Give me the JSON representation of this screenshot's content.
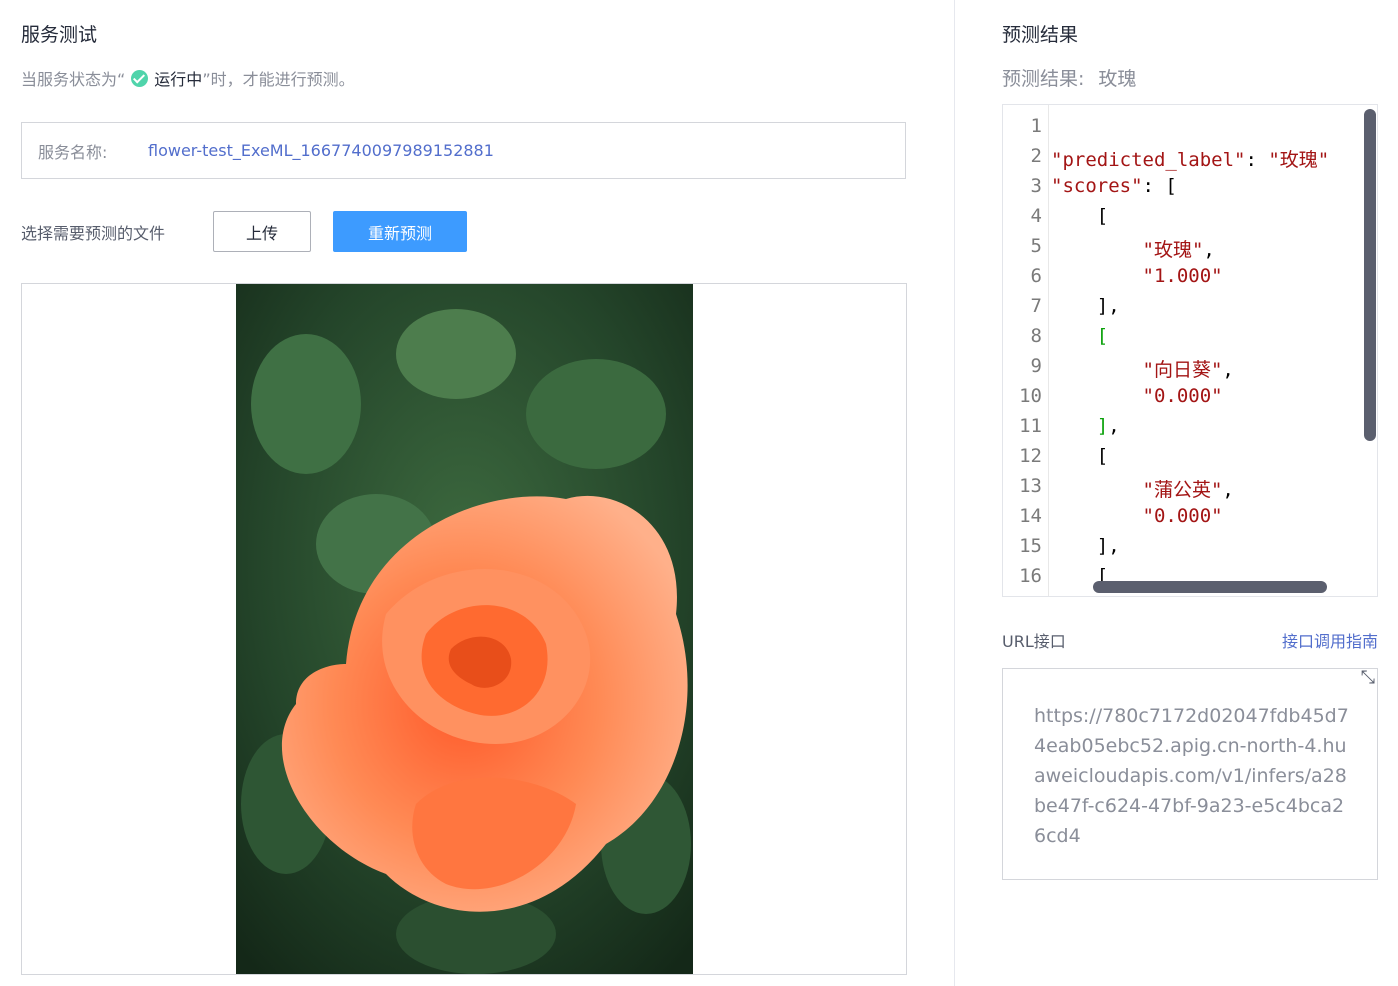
{
  "left": {
    "title": "服务测试",
    "note_prefix": "当服务状态为“",
    "note_status": "运行中",
    "note_suffix": " ”时，才能进行预测。",
    "service_label": "服务名称:",
    "service_name": "flower-test_ExeML_1667740097989152881",
    "file_label": "选择需要预测的文件",
    "upload_button": "上传",
    "repredict_button": "重新预测"
  },
  "right": {
    "title": "预测结果",
    "result_label": "预测结果:",
    "result_value": "玫瑰",
    "line_numbers": [
      "1",
      "2",
      "3",
      "4",
      "5",
      "6",
      "7",
      "8",
      "9",
      "10",
      "11",
      "12",
      "13",
      "14",
      "15",
      "16"
    ],
    "code": {
      "l2_key": "\"predicted_label\"",
      "l2_val": "\"玫瑰\"",
      "l3_key": "\"scores\"",
      "l5": "\"玫瑰\"",
      "l6": "\"1.000\"",
      "l9": "\"向日葵\"",
      "l10": "\"0.000\"",
      "l13": "\"蒲公英\"",
      "l14": "\"0.000\""
    },
    "url_label": "URL接口",
    "url_guide_link": "接口调用指南",
    "url_value": "https://780c7172d02047fdb45d74eab05ebc52.apig.cn-north-4.huaweicloudapis.com/v1/infers/a28be47f-c624-47bf-9a23-e5c4bca26cd4"
  },
  "colors": {
    "accent": "#3d9bff",
    "link": "#526ecc",
    "status_green": "#50d4ab"
  },
  "icons": {
    "status": "check-circle-icon",
    "resize": "resize-icon"
  }
}
